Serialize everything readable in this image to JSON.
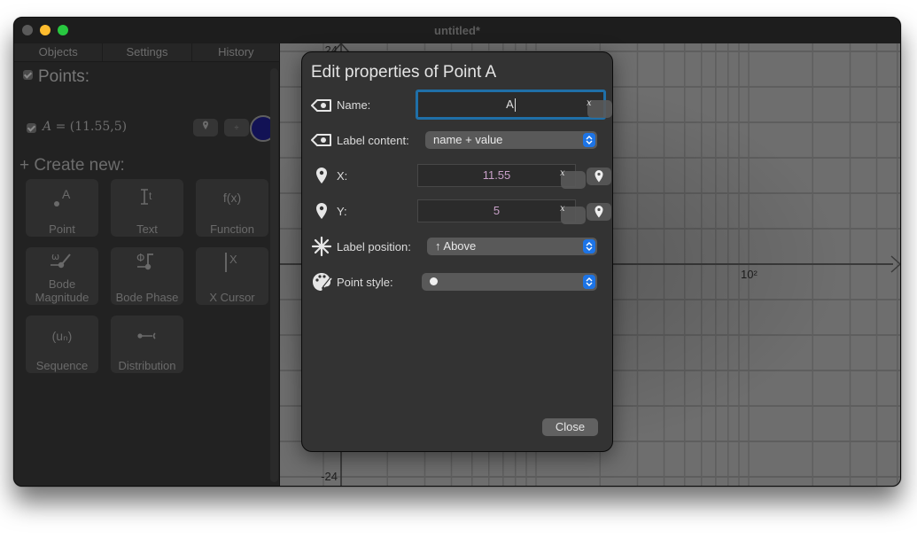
{
  "window": {
    "title": "untitled*"
  },
  "sidebar": {
    "tabs": [
      {
        "label": "Objects"
      },
      {
        "label": "Settings"
      },
      {
        "label": "History"
      }
    ],
    "points_section": {
      "title": "Points:",
      "checked": true
    },
    "objects": [
      {
        "name": "A",
        "formula_lhs": "A",
        "formula_rhs": " = (11.55,5)",
        "visible": true,
        "color": "#121255",
        "select_glyph": "÷"
      }
    ],
    "create_title": "+ Create new:",
    "create_buttons": [
      {
        "label": "Point",
        "icon": "point-icon"
      },
      {
        "label": "Text",
        "icon": "text-icon"
      },
      {
        "label": "Function",
        "icon": "function-icon",
        "glyph": "f(x)"
      },
      {
        "label": "Bode Magnitude",
        "icon": "bode-magnitude-icon",
        "glyph": "ω"
      },
      {
        "label": "Bode Phase",
        "icon": "bode-phase-icon",
        "glyph": "Φ"
      },
      {
        "label": "X Cursor",
        "icon": "x-cursor-icon",
        "glyph": "X"
      },
      {
        "label": "Sequence",
        "icon": "sequence-icon",
        "glyph": "(uₙ)"
      },
      {
        "label": "Distribution",
        "icon": "distribution-icon"
      }
    ]
  },
  "canvas": {
    "x_axis": {
      "scale": "log",
      "tick_label": "10²"
    },
    "y_axis": {
      "top_label": "24",
      "bottom_label": "-24"
    },
    "grid_color": "#5e5e5e",
    "background": "#6e6e6e"
  },
  "dialog": {
    "title": "Edit properties of Point A",
    "fields": {
      "name": {
        "label": "Name:",
        "value": "A",
        "icon": "label-tag-icon"
      },
      "label_content": {
        "label": "Label content:",
        "value": "name + value",
        "icon": "label-tag-icon"
      },
      "x": {
        "label": "X:",
        "value": "11.55",
        "icon": "map-pin-icon",
        "var_glyph": "x"
      },
      "y": {
        "label": "Y:",
        "value": "5",
        "icon": "map-pin-icon",
        "var_glyph": "x"
      },
      "label_position": {
        "label": "Label position:",
        "value": "↑ Above",
        "icon": "asterisk-arrows-icon"
      },
      "point_style": {
        "label": "Point style:",
        "value": "●",
        "icon": "palette-icon"
      }
    },
    "close_label": "Close",
    "accent_color": "#1d74e6",
    "focus_color": "#1f6fa8"
  }
}
